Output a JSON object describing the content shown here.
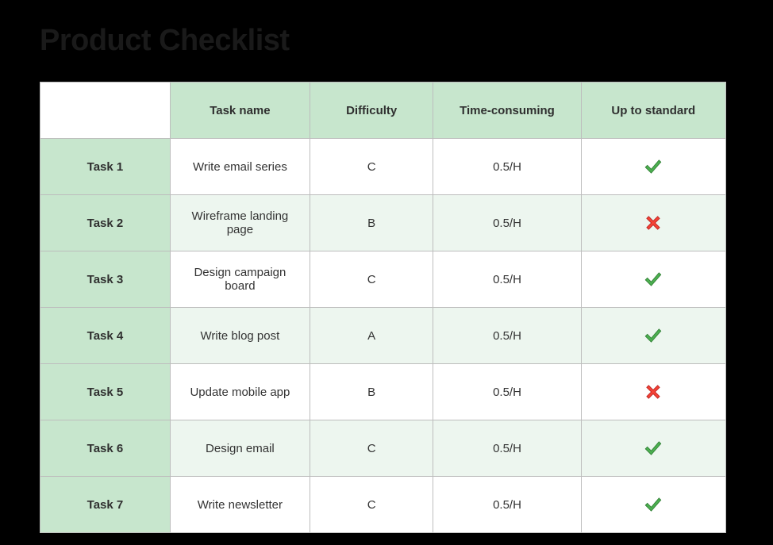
{
  "title": "Product Checklist",
  "columns": {
    "task_name": "Task name",
    "difficulty": "Difficulty",
    "time": "Time-consuming",
    "standard": "Up to standard"
  },
  "rows": [
    {
      "label": "Task 1",
      "name": "Write email series",
      "difficulty": "C",
      "time": "0.5/H",
      "status": "check"
    },
    {
      "label": "Task 2",
      "name": "Wireframe landing page",
      "difficulty": "B",
      "time": "0.5/H",
      "status": "cross"
    },
    {
      "label": "Task 3",
      "name": "Design campaign board",
      "difficulty": "C",
      "time": "0.5/H",
      "status": "check"
    },
    {
      "label": "Task 4",
      "name": "Write blog post",
      "difficulty": "A",
      "time": "0.5/H",
      "status": "check"
    },
    {
      "label": "Task 5",
      "name": "Update mobile app",
      "difficulty": "B",
      "time": "0.5/H",
      "status": "cross"
    },
    {
      "label": "Task 6",
      "name": "Design email",
      "difficulty": "C",
      "time": "0.5/H",
      "status": "check"
    },
    {
      "label": "Task 7",
      "name": "Write newsletter",
      "difficulty": "C",
      "time": "0.5/H",
      "status": "check"
    }
  ]
}
